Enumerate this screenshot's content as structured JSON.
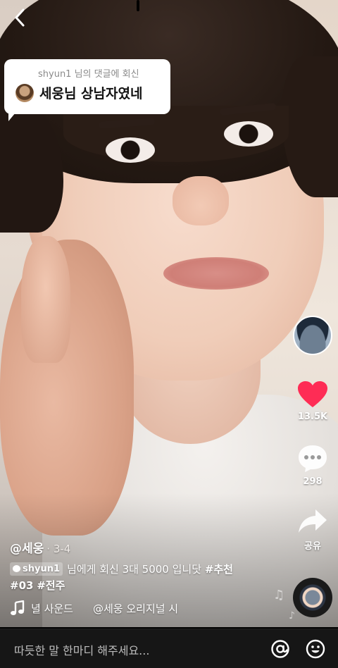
{
  "reply_bubble": {
    "subtitle": "shyun1 님의 댓글에 회신",
    "comment": "세웅님 상남자였네"
  },
  "actions": {
    "likes": "13.5K",
    "comments": "298",
    "share": "공유"
  },
  "post": {
    "author": "@세웅",
    "date": "· 3-4",
    "reply_chip": "shyun1",
    "caption_text": "님에게 회신 3대 5000 입니닷",
    "hashtags": [
      "#추천",
      "#03",
      "#전주"
    ]
  },
  "music": {
    "track_a": "녈 사운드",
    "track_b": "@세웅 오리지널 시"
  },
  "comment_bar": {
    "placeholder": "따듯한 말 한마디 해주세요..."
  },
  "colors": {
    "like": "#fe2c55",
    "bar_bg": "#161616"
  },
  "icons": [
    "back-arrow-icon",
    "heart-icon",
    "comment-icon",
    "share-icon",
    "music-note-icon",
    "mention-icon",
    "emoji-icon"
  ]
}
